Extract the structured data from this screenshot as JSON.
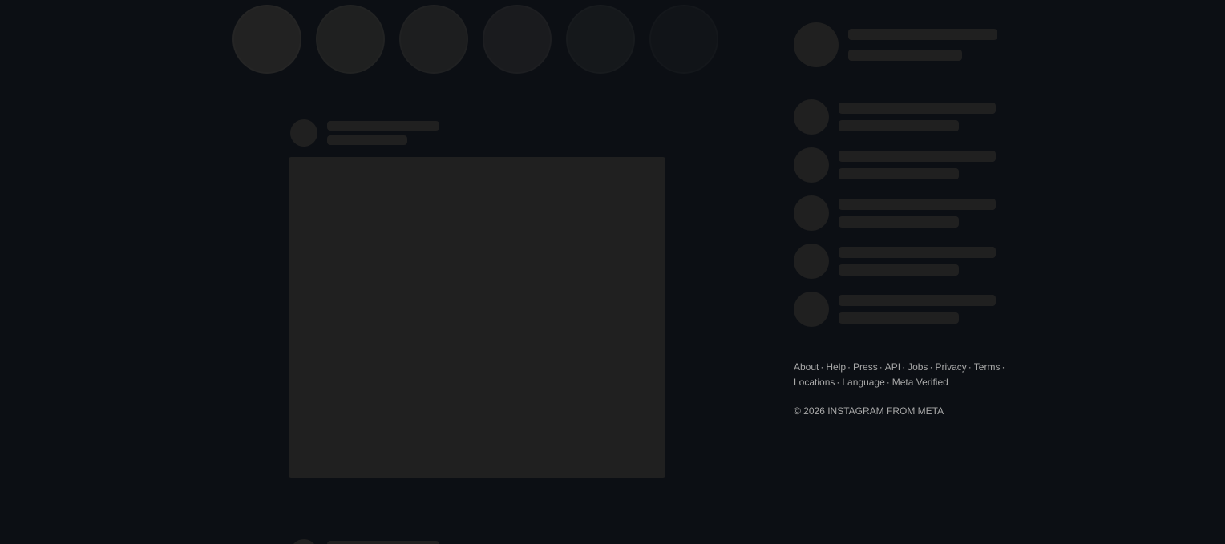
{
  "footer": {
    "links": [
      {
        "label": "About"
      },
      {
        "label": "Help"
      },
      {
        "label": "Press"
      },
      {
        "label": "API"
      },
      {
        "label": "Jobs"
      },
      {
        "label": "Privacy"
      },
      {
        "label": "Terms"
      },
      {
        "label": "Locations"
      },
      {
        "label": "Language"
      },
      {
        "label": "Meta Verified"
      }
    ],
    "copyright": "© 2026 INSTAGRAM FROM META"
  },
  "colors": {
    "background": "#0c0f14",
    "skeleton": "#202020",
    "footer_text": "#a8a8a8"
  }
}
